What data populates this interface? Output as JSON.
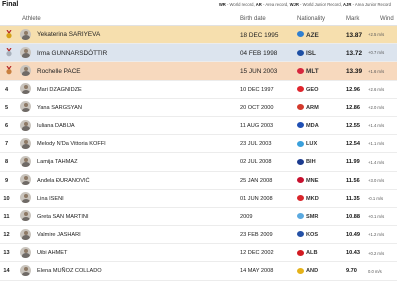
{
  "page": {
    "title": "Final",
    "legend": [
      {
        "code": "WR",
        "text": "World record"
      },
      {
        "code": "AR",
        "text": "Area record"
      },
      {
        "code": "WJR",
        "text": "World Junior Record"
      },
      {
        "code": "AJR",
        "text": "Area Junior Record"
      }
    ]
  },
  "columns": {
    "athlete": "Athlete",
    "birth_date": "Birth date",
    "nationality": "Nationality",
    "mark": "Mark",
    "wind": "Wind"
  },
  "rows": [
    {
      "rank": "",
      "medal": "gold",
      "name": "Yekaterina SARIYEVA",
      "birth": "18 DEC 1995",
      "nat": "AZE",
      "flag_color": "#2f7fd1",
      "mark": "13.87",
      "wind": "+2.5 m/s"
    },
    {
      "rank": "",
      "medal": "silver",
      "name": "Irma GUNNARSDÓTTIR",
      "birth": "04 FEB 1998",
      "nat": "ISL",
      "flag_color": "#1e4fa3",
      "mark": "13.72",
      "wind": "+0.7 m/s"
    },
    {
      "rank": "",
      "medal": "bronze",
      "name": "Rochelle PACE",
      "birth": "15 JUN 2003",
      "nat": "MLT",
      "flag_color": "#d7263d",
      "mark": "13.39",
      "wind": "+1.6 m/s"
    },
    {
      "rank": "4",
      "medal": "",
      "name": "Mari DZAGNIDZE",
      "birth": "10 DEC 1997",
      "nat": "GEO",
      "flag_color": "#e0262d",
      "mark": "12.96",
      "wind": "+2.6 m/s"
    },
    {
      "rank": "5",
      "medal": "",
      "name": "Yana SARGSYAN",
      "birth": "20 OCT 2000",
      "nat": "ARM",
      "flag_color": "#d33a2c",
      "mark": "12.86",
      "wind": "+2.0 m/s"
    },
    {
      "rank": "6",
      "medal": "",
      "name": "Iuliana DABIJA",
      "birth": "11 AUG 2003",
      "nat": "MDA",
      "flag_color": "#1f4fb4",
      "mark": "12.55",
      "wind": "+1.4 m/s"
    },
    {
      "rank": "7",
      "medal": "",
      "name": "Melody N'Da Vittoria KOFFI",
      "birth": "23 JUL 2003",
      "nat": "LUX",
      "flag_color": "#3aa0dc",
      "mark": "12.54",
      "wind": "+1.1 m/s"
    },
    {
      "rank": "8",
      "medal": "",
      "name": "Lamija TAHMAZ",
      "birth": "02 JUL 2008",
      "nat": "BIH",
      "flag_color": "#1c3b8f",
      "mark": "11.99",
      "wind": "+1.4 m/s"
    },
    {
      "rank": "9",
      "medal": "",
      "name": "Anđela ĐURANOVIĆ",
      "birth": "25 JAN 2008",
      "nat": "MNE",
      "flag_color": "#c8102e",
      "mark": "11.56",
      "wind": "+3.0 m/s"
    },
    {
      "rank": "10",
      "medal": "",
      "name": "Lina ISENI",
      "birth": "01 JUN 2008",
      "nat": "MKD",
      "flag_color": "#d9262b",
      "mark": "11.35",
      "wind": "-0.1 m/s"
    },
    {
      "rank": "11",
      "medal": "",
      "name": "Greta SAN MARTINI",
      "birth": "2009",
      "nat": "SMR",
      "flag_color": "#5aa9e0",
      "mark": "10.88",
      "wind": "+0.1 m/s"
    },
    {
      "rank": "12",
      "medal": "",
      "name": "Valmire JASHARI",
      "birth": "23 FEB 2009",
      "nat": "KOS",
      "flag_color": "#2451a6",
      "mark": "10.49",
      "wind": "+1.2 m/s"
    },
    {
      "rank": "13",
      "medal": "",
      "name": "Uibi AHMET",
      "birth": "12 DEC 2002",
      "nat": "ALB",
      "flag_color": "#d21a21",
      "mark": "10.43",
      "wind": "+0.2 m/s"
    },
    {
      "rank": "14",
      "medal": "",
      "name": "Elena MUÑOZ COLLADO",
      "birth": "14 MAY 2008",
      "nat": "AND",
      "flag_color": "#e5b219",
      "mark": "9.70",
      "wind": "0.0 m/s"
    }
  ]
}
